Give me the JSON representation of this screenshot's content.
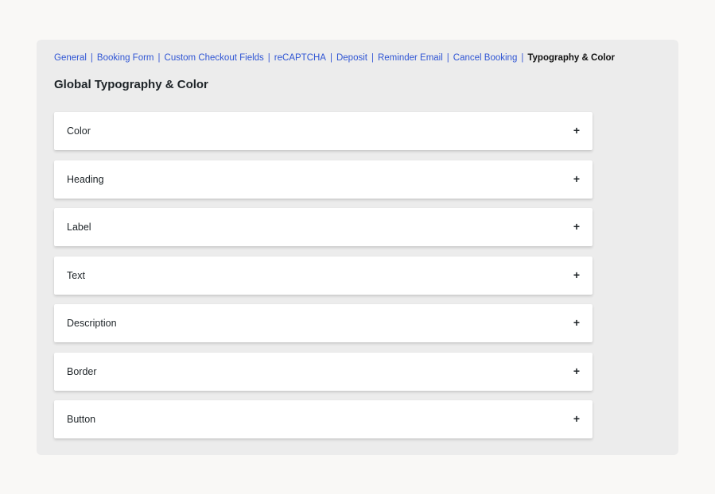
{
  "subnav": {
    "items": [
      {
        "label": "General"
      },
      {
        "label": "Booking Form"
      },
      {
        "label": "Custom Checkout Fields"
      },
      {
        "label": "reCAPTCHA"
      },
      {
        "label": "Deposit"
      },
      {
        "label": "Reminder Email"
      },
      {
        "label": "Cancel Booking"
      },
      {
        "label": "Typography & Color",
        "current": true
      }
    ],
    "separator": "|"
  },
  "page": {
    "title": "Global Typography & Color"
  },
  "accordion": {
    "sections": [
      {
        "label": "Color",
        "toggle": "+"
      },
      {
        "label": "Heading",
        "toggle": "+"
      },
      {
        "label": "Label",
        "toggle": "+"
      },
      {
        "label": "Text",
        "toggle": "+"
      },
      {
        "label": "Description",
        "toggle": "+"
      },
      {
        "label": "Border",
        "toggle": "+"
      },
      {
        "label": "Button",
        "toggle": "+"
      }
    ]
  },
  "colors": {
    "link": "#2f55d4",
    "current": "#111111",
    "panel_bg": "#ececec",
    "page_bg": "#f9f8f6"
  }
}
